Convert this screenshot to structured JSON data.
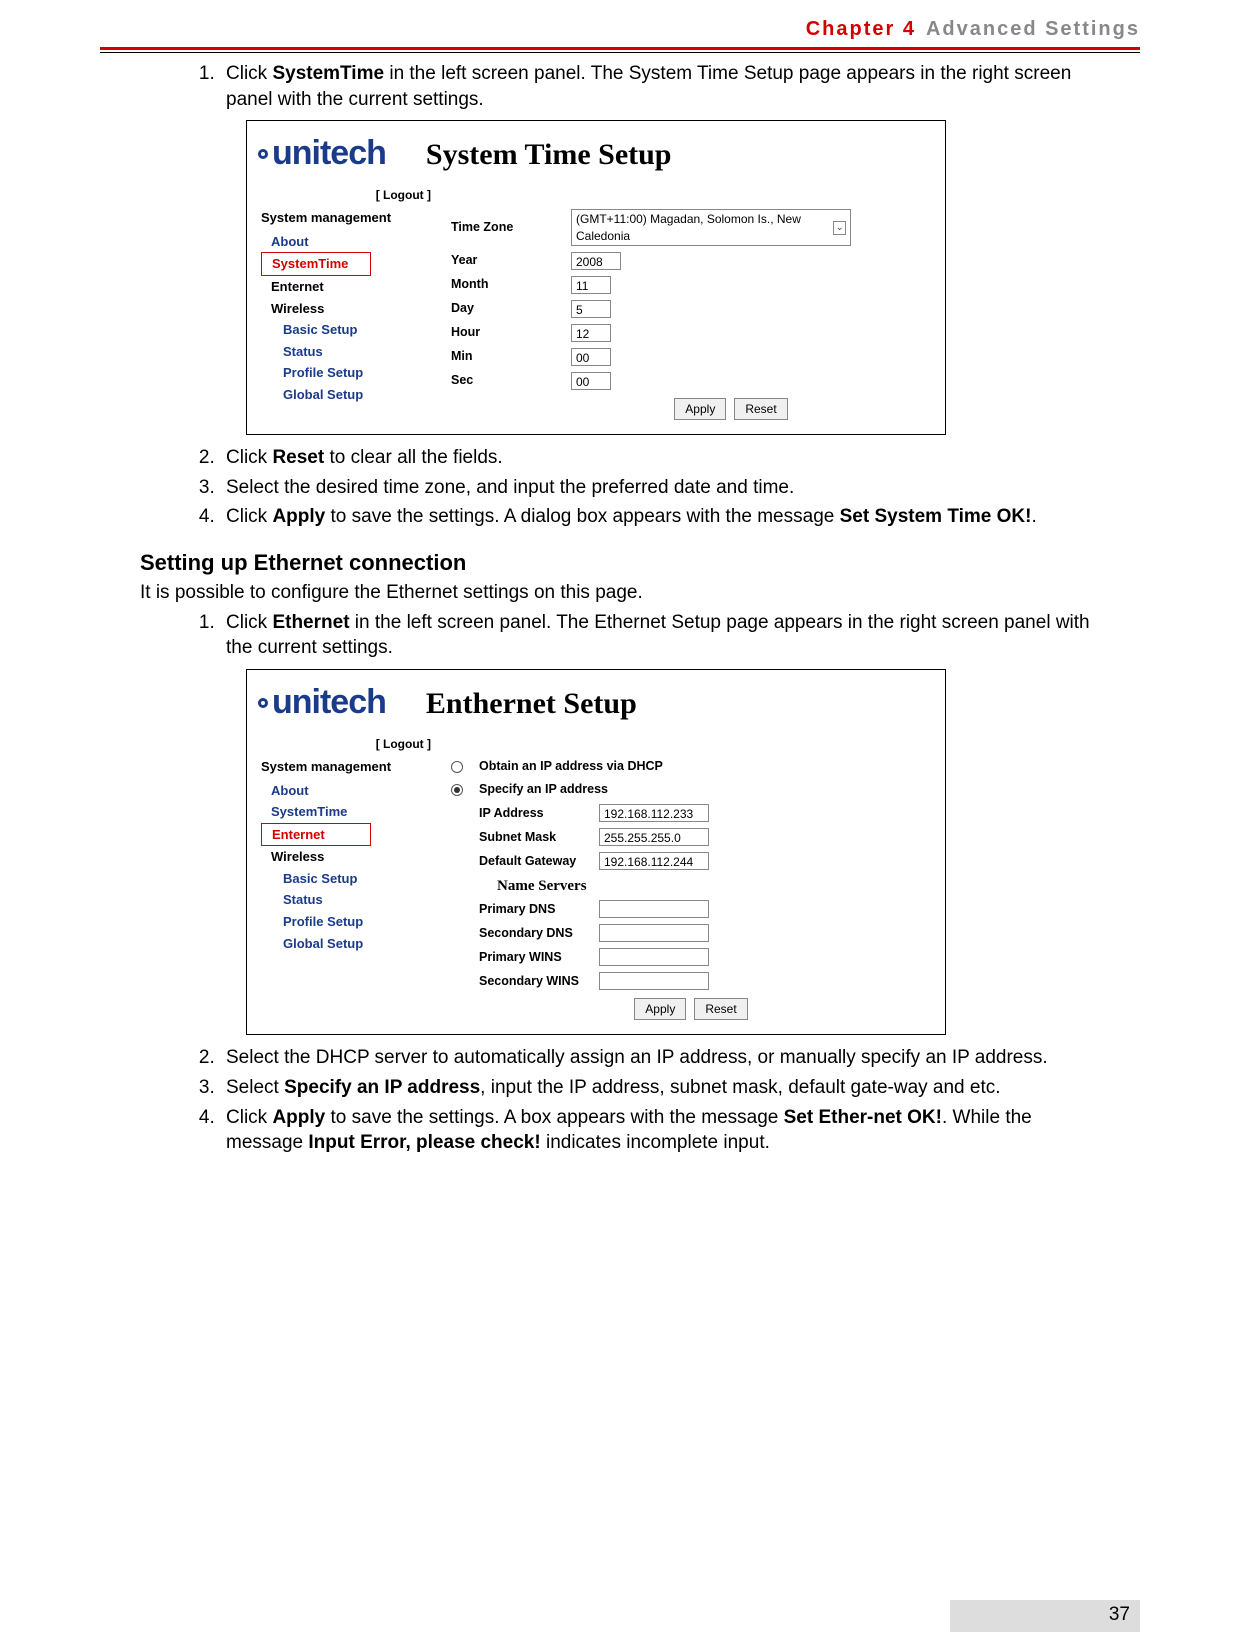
{
  "header": {
    "chapter": "Chapter 4",
    "title": "Advanced Settings"
  },
  "section1": {
    "steps": [
      {
        "pre": "Click ",
        "bold1": "SystemTime",
        "post1": " in the left screen panel. The System Time Setup page appears in the right screen panel with the current settings."
      },
      {
        "pre": "Click ",
        "bold1": "Reset",
        "post1": " to clear all the fields."
      },
      {
        "pre": "Select the desired time zone, and input the preferred date and time."
      },
      {
        "pre": "Click ",
        "bold1": "Apply",
        "post1": " to save the settings. A dialog box appears with the message ",
        "bold2": "Set System Time OK!",
        "post2": "."
      }
    ],
    "screenshot": {
      "brand": "unitech",
      "title": "System Time Setup",
      "logout": "[ Logout ]",
      "nav_header": "System management",
      "nav": [
        "About",
        "SystemTime",
        "Enternet",
        "Wireless",
        "Basic Setup",
        "Status",
        "Profile Setup",
        "Global Setup"
      ],
      "nav_selected_index": 1,
      "nav_sub_from": 4,
      "fields": {
        "timezone_label": "Time Zone",
        "timezone_value": "(GMT+11:00) Magadan, Solomon Is., New Caledonia",
        "year_label": "Year",
        "year_value": "2008",
        "month_label": "Month",
        "month_value": "11",
        "day_label": "Day",
        "day_value": "5",
        "hour_label": "Hour",
        "hour_value": "12",
        "min_label": "Min",
        "min_value": "00",
        "sec_label": "Sec",
        "sec_value": "00"
      },
      "buttons": {
        "apply": "Apply",
        "reset": "Reset"
      }
    }
  },
  "section2": {
    "heading": "Setting up Ethernet connection",
    "intro": "It is possible to configure the Ethernet settings on this page.",
    "steps": [
      {
        "pre": "Click ",
        "bold1": "Ethernet",
        "post1": " in the left screen panel. The Ethernet Setup page appears in the right screen panel with the current settings."
      },
      {
        "pre": "Select the DHCP server to automatically assign an IP address, or manually specify an IP address."
      },
      {
        "pre": "Select ",
        "bold1": "Specify an IP address",
        "post1": ", input the IP address, subnet mask, default gate-way and etc."
      },
      {
        "pre": "Click ",
        "bold1": "Apply",
        "post1": " to save the settings. A box appears with the message ",
        "bold2": "Set Ether-net OK!",
        "post2": ". While the message ",
        "bold3": "Input Error, please check!",
        "post3": " indicates incomplete input."
      }
    ],
    "screenshot": {
      "brand": "unitech",
      "title": "Enthernet Setup",
      "logout": "[ Logout ]",
      "nav_header": "System management",
      "nav": [
        "About",
        "SystemTime",
        "Enternet",
        "Wireless",
        "Basic Setup",
        "Status",
        "Profile Setup",
        "Global Setup"
      ],
      "nav_selected_index": 2,
      "nav_sub_from": 4,
      "radio_dhcp": "Obtain an IP address via DHCP",
      "radio_static": "Specify an IP address",
      "fields": {
        "ip_label": "IP Address",
        "ip_value": "192.168.112.233",
        "mask_label": "Subnet Mask",
        "mask_value": "255.255.255.0",
        "gw_label": "Default Gateway",
        "gw_value": "192.168.112.244",
        "ns_header": "Name Servers",
        "pdns_label": "Primary DNS",
        "pdns_value": "",
        "sdns_label": "Secondary DNS",
        "sdns_value": "",
        "pwins_label": "Primary WINS",
        "pwins_value": "",
        "swins_label": "Secondary WINS",
        "swins_value": ""
      },
      "buttons": {
        "apply": "Apply",
        "reset": "Reset"
      }
    }
  },
  "page_number": "37"
}
